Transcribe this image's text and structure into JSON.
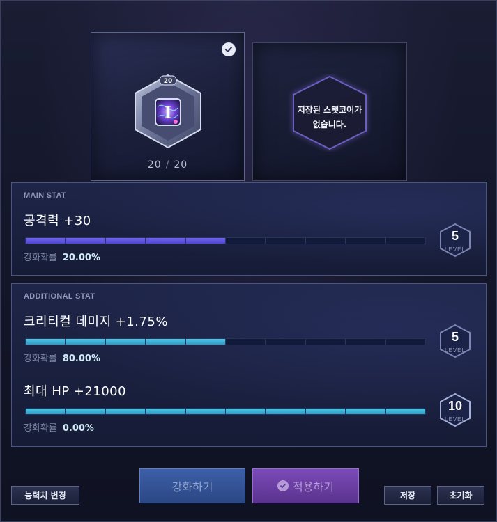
{
  "core_slots": {
    "current": {
      "count": "20",
      "max": "20",
      "separator": "/",
      "core_level": "20",
      "glyph": "I",
      "selected": true
    },
    "saved": {
      "empty_line1": "저장된 스탯코어가",
      "empty_line2": "없습니다."
    }
  },
  "main_stat": {
    "section_title": "MAIN STAT",
    "stats": [
      {
        "name": "공격력",
        "value": "+30",
        "chance_label": "강화확률",
        "chance": "20.00%",
        "level": "5",
        "level_label": "LEVEL",
        "progress": 0.5
      }
    ]
  },
  "additional_stat": {
    "section_title": "ADDITIONAL STAT",
    "stats": [
      {
        "name": "크리티컬 데미지",
        "value": "+1.75%",
        "chance_label": "강화확률",
        "chance": "80.00%",
        "level": "5",
        "level_label": "LEVEL",
        "progress": 0.5
      },
      {
        "name": "최대 HP",
        "value": "+21000",
        "chance_label": "강화확률",
        "chance": "0.00%",
        "level": "10",
        "level_label": "LEVEL",
        "progress": 1.0
      }
    ]
  },
  "buttons": {
    "change_ability": "능력치 변경",
    "enhance": "강화하기",
    "apply": "적용하기",
    "save": "저장",
    "reset": "초기화"
  },
  "colors": {
    "main_bar": "#5b51e0",
    "additional_bar": "#3bb3dc",
    "enhance_button": "#3d5fa8",
    "apply_button": "#7b4ab8"
  },
  "icons": [
    "check-circle-icon",
    "stat-core-icon",
    "hexagon-frame-icon",
    "level-hexagon-icon"
  ]
}
